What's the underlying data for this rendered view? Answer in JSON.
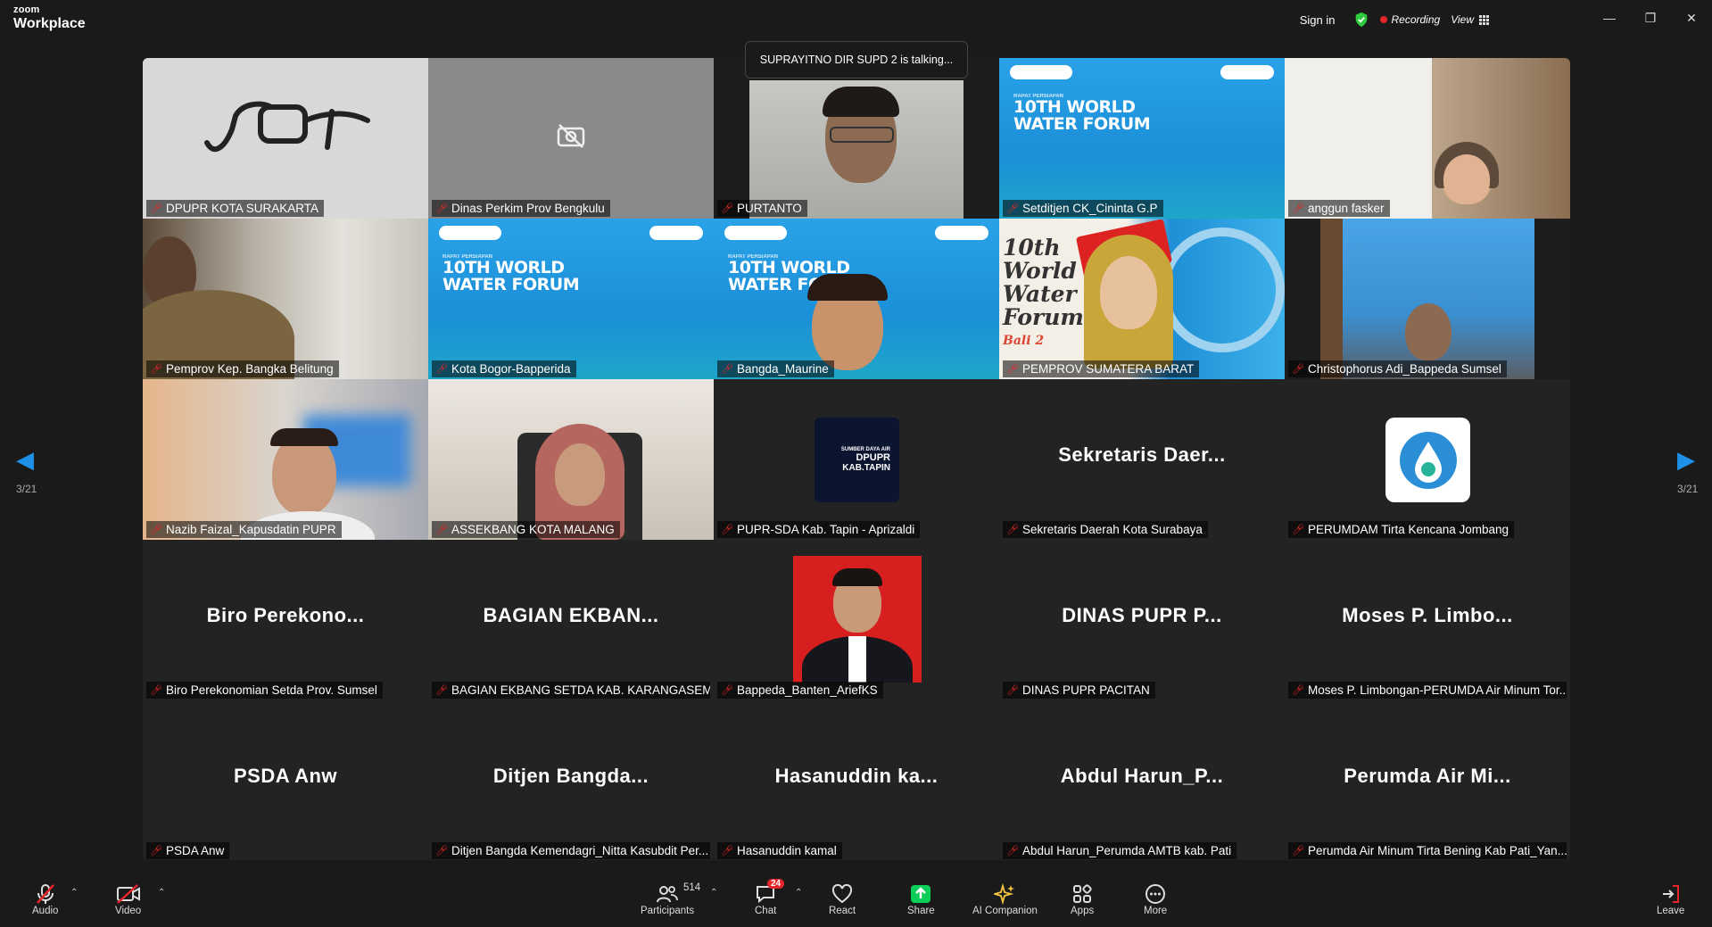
{
  "app": {
    "logo_line1": "zoom",
    "logo_line2": "Workplace"
  },
  "titlebar": {
    "sign_in": "Sign in",
    "recording": "Recording",
    "view": "View"
  },
  "talking_banner": "SUPRAYITNO DIR SUPD 2 is talking...",
  "page_indicator": {
    "left": "3/21",
    "right": "3/21"
  },
  "tiles": [
    {
      "name": "DPUPR KOTA SURAKARTA"
    },
    {
      "name": "Dinas Perkim Prov Bengkulu"
    },
    {
      "name": "PURTANTO"
    },
    {
      "name": "Setditjen CK_Cininta G.P"
    },
    {
      "name": "anggun fasker"
    },
    {
      "name": "Pemprov Kep. Bangka Belitung"
    },
    {
      "name": "Kota Bogor-Bapperida"
    },
    {
      "name": "Bangda_Maurine"
    },
    {
      "name": "PEMPROV SUMATERA BARAT"
    },
    {
      "name": "Christophorus Adi_Bappeda Sumsel"
    },
    {
      "name": "Nazib Faizal_Kapusdatin PUPR"
    },
    {
      "name": "ASSEKBANG KOTA MALANG"
    },
    {
      "name": "PUPR-SDA Kab. Tapin - Aprizaldi"
    },
    {
      "name": "Sekretaris Daerah Kota Surabaya",
      "big": "Sekretaris Daer..."
    },
    {
      "name": "PERUMDAM Tirta Kencana Jombang"
    },
    {
      "name": "Biro Perekonomian Setda Prov. Sumsel",
      "big": "Biro Perekono..."
    },
    {
      "name": "BAGIAN EKBANG SETDA KAB. KARANGASEM",
      "big": "BAGIAN EKBAN..."
    },
    {
      "name": "Bappeda_Banten_AriefKS"
    },
    {
      "name": "DINAS PUPR PACITAN",
      "big": "DINAS PUPR P..."
    },
    {
      "name": "Moses P. Limbongan-PERUMDA Air Minum Tor...",
      "big": "Moses P. Limbo..."
    },
    {
      "name": "PSDA Anw",
      "big": "PSDA Anw"
    },
    {
      "name": "Ditjen Bangda Kemendagri_Nitta Kasubdit Per...",
      "big": "Ditjen Bangda..."
    },
    {
      "name": "Hasanuddin kamal",
      "big": "Hasanuddin ka..."
    },
    {
      "name": "Abdul Harun_Perumda AMTB kab. Pati",
      "big": "Abdul Harun_P..."
    },
    {
      "name": "Perumda Air Minum Tirta Bening Kab Pati_Yan...",
      "big": "Perumda Air Mi..."
    }
  ],
  "slide": {
    "title1": "10TH WORLD",
    "title2": "WATER FORUM",
    "sub": "RAPAT PERSIAPAN",
    "alt1": "10th",
    "alt2": "World",
    "alt3": "Water",
    "alt4": "Forum",
    "alt5": "Bali 2"
  },
  "tapin_logo": {
    "l1": "SUMBER DAYA AIR",
    "l2": "DPUPR",
    "l3": "KAB.TAPIN"
  },
  "toolbar": {
    "audio": "Audio",
    "video": "Video",
    "participants": "Participants",
    "participants_count": "514",
    "chat": "Chat",
    "chat_badge": "24",
    "react": "React",
    "share": "Share",
    "ai": "AI Companion",
    "apps": "Apps",
    "more": "More",
    "leave": "Leave"
  },
  "colors": {
    "accent": "#1e90e8",
    "record": "#e5252a",
    "share": "#0ccf5a",
    "background": "#1a1a1a"
  }
}
